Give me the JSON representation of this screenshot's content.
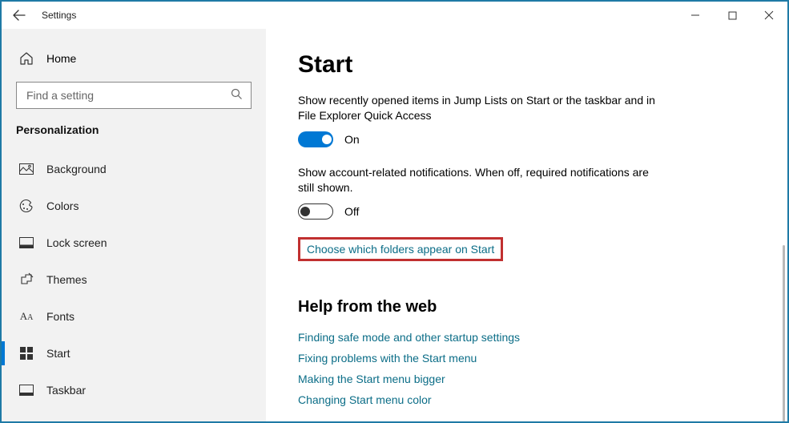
{
  "titlebar": {
    "title": "Settings"
  },
  "sidebar": {
    "home_label": "Home",
    "search_placeholder": "Find a setting",
    "section_header": "Personalization",
    "items": [
      {
        "label": "Background"
      },
      {
        "label": "Colors"
      },
      {
        "label": "Lock screen"
      },
      {
        "label": "Themes"
      },
      {
        "label": "Fonts"
      },
      {
        "label": "Start"
      },
      {
        "label": "Taskbar"
      }
    ]
  },
  "main": {
    "title": "Start",
    "setting1": {
      "desc": "Show recently opened items in Jump Lists on Start or the taskbar and in File Explorer Quick Access",
      "state_label": "On"
    },
    "setting2": {
      "desc": "Show account-related notifications. When off, required notifications are still shown.",
      "state_label": "Off"
    },
    "folders_link": "Choose which folders appear on Start",
    "help_title": "Help from the web",
    "help_links": [
      "Finding safe mode and other startup settings",
      "Fixing problems with the Start menu",
      "Making the Start menu bigger",
      "Changing Start menu color"
    ]
  }
}
